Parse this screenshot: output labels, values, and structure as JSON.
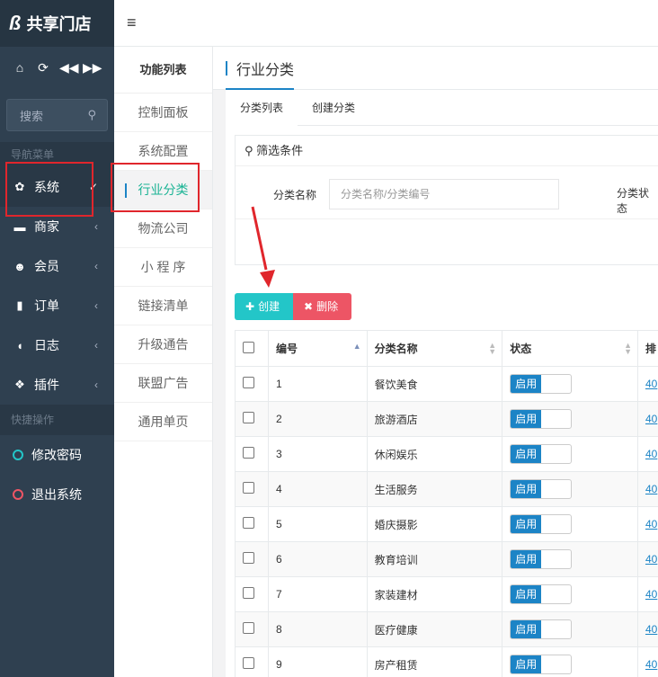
{
  "brand": {
    "logo": "ß",
    "title": "共享门店"
  },
  "sidebar": {
    "search_placeholder": "搜索",
    "nav_header": "导航菜单",
    "items": [
      {
        "label": "系统",
        "icon": "gear-icon",
        "active": true
      },
      {
        "label": "商家",
        "icon": "briefcase-icon"
      },
      {
        "label": "会员",
        "icon": "users-icon"
      },
      {
        "label": "订单",
        "icon": "bookmark-icon"
      },
      {
        "label": "日志",
        "icon": "shield-icon"
      },
      {
        "label": "插件",
        "icon": "cubes-icon"
      }
    ],
    "quick_header": "快捷操作",
    "quick_items": [
      {
        "label": "修改密码",
        "color": "#23c6c8"
      },
      {
        "label": "退出系统",
        "color": "#ed5565"
      }
    ]
  },
  "topbar": {
    "menu_icon": "hamburger-icon"
  },
  "submenu": {
    "title": "功能列表",
    "items": [
      "控制面板",
      "系统配置",
      "行业分类",
      "物流公司",
      "小 程 序",
      "链接清单",
      "升级通告",
      "联盟广告",
      "通用单页"
    ],
    "active_index": 2
  },
  "page": {
    "title": "行业分类",
    "tabs": [
      "分类列表",
      "创建分类"
    ],
    "filter_title": "筛选条件",
    "filter_name_label": "分类名称",
    "filter_name_placeholder": "分类名称/分类编号",
    "filter_status_label": "分类状态",
    "create_label": "创建",
    "delete_label": "删除"
  },
  "table": {
    "headers": [
      "编号",
      "分类名称",
      "状态",
      "排"
    ],
    "switch_label": "启用",
    "rows": [
      {
        "id": "1",
        "name": "餐饮美食",
        "link": "40"
      },
      {
        "id": "2",
        "name": "旅游酒店",
        "link": "40"
      },
      {
        "id": "3",
        "name": "休闲娱乐",
        "link": "40"
      },
      {
        "id": "4",
        "name": "生活服务",
        "link": "40"
      },
      {
        "id": "5",
        "name": "婚庆摄影",
        "link": "40"
      },
      {
        "id": "6",
        "name": "教育培训",
        "link": "40"
      },
      {
        "id": "7",
        "name": "家装建材",
        "link": "40"
      },
      {
        "id": "8",
        "name": "医疗健康",
        "link": "40"
      },
      {
        "id": "9",
        "name": "房产租赁",
        "link": "40"
      }
    ]
  },
  "colors": {
    "sidebar": "#2f4050",
    "accent": "#1c84c6",
    "create": "#23c6c8",
    "delete": "#ed5565",
    "highlight": "#e0262c"
  }
}
